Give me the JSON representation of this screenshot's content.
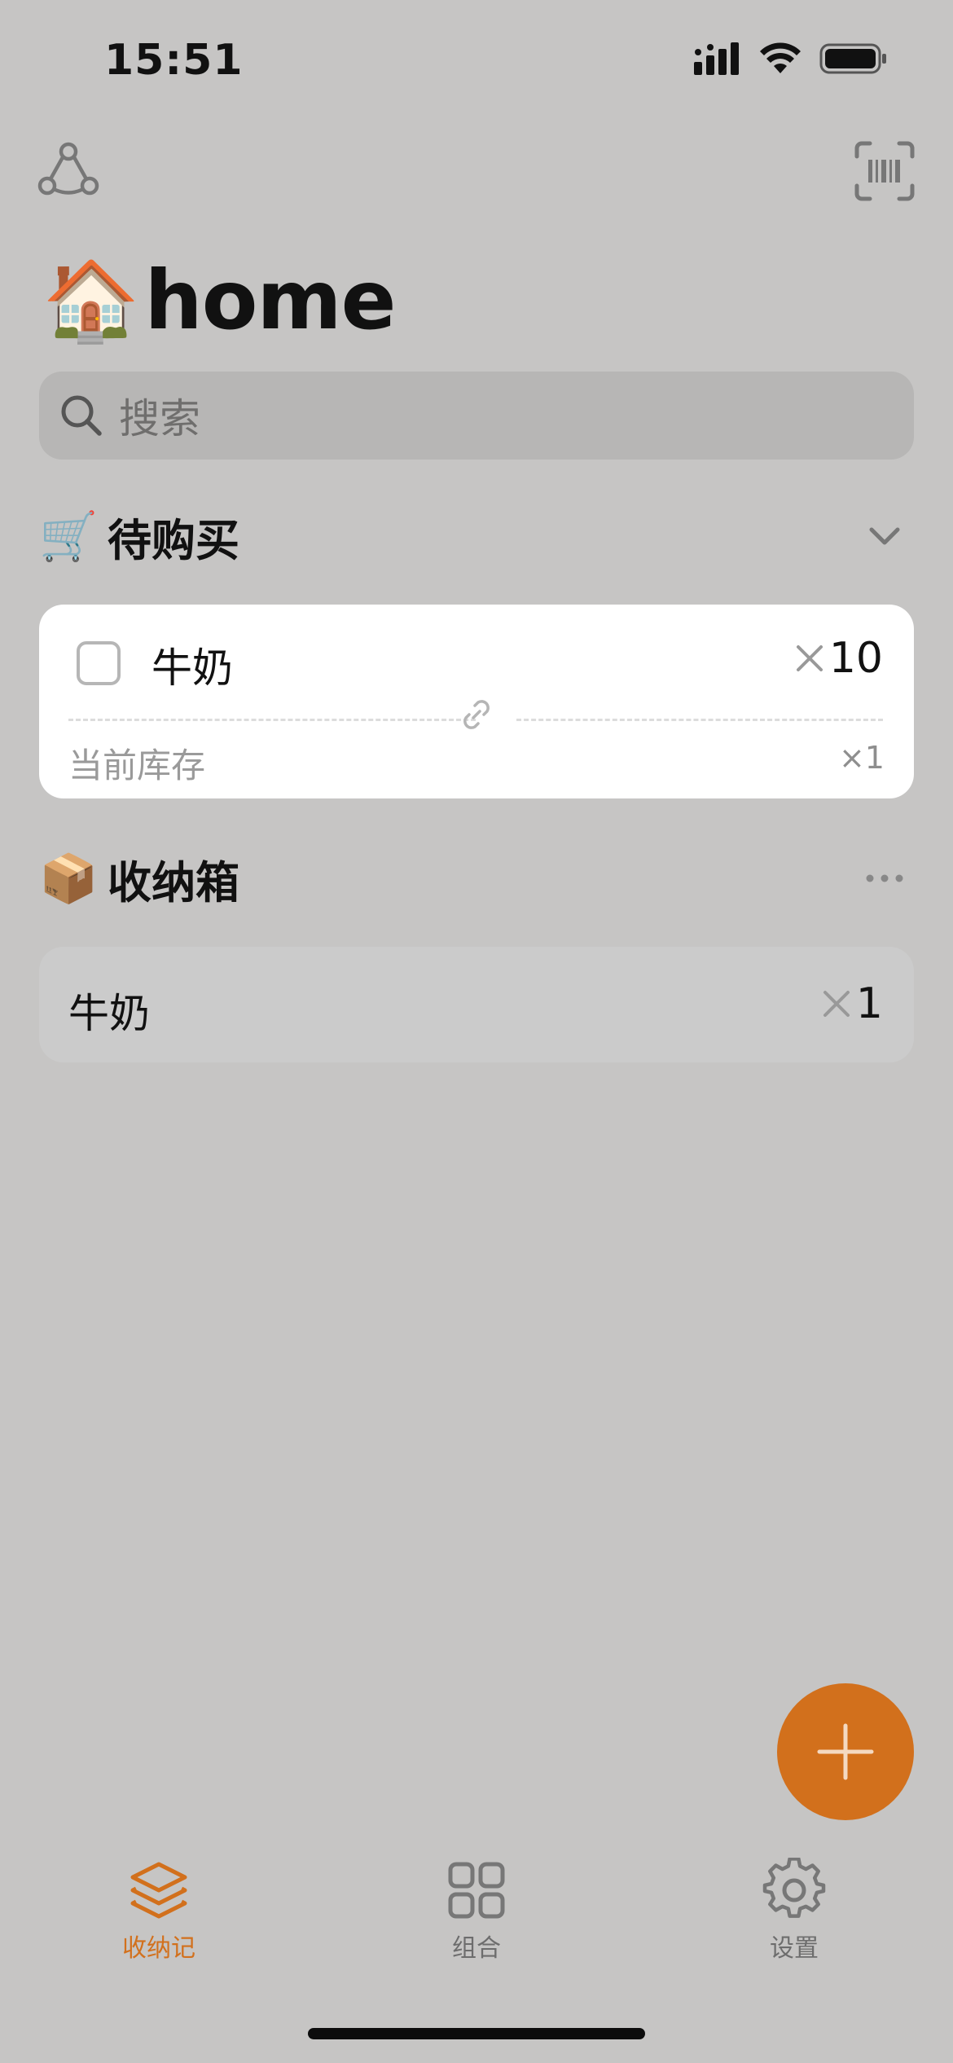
{
  "status_bar": {
    "time": "15:51"
  },
  "header": {
    "title_emoji": "🏠",
    "title": "home",
    "share_icon": "share-nodes-icon",
    "scan_icon": "barcode-scan-icon"
  },
  "search": {
    "placeholder": "搜索"
  },
  "shopping_section": {
    "emoji": "🛒",
    "title": "待购买",
    "items": [
      {
        "name": "牛奶",
        "quantity": "10",
        "stock_label": "当前库存",
        "stock_quantity": "×1",
        "checked": false
      }
    ]
  },
  "storage_section": {
    "emoji": "📦",
    "title": "收纳箱",
    "items": [
      {
        "name": "牛奶",
        "quantity": "1"
      }
    ]
  },
  "tabs": [
    {
      "label": "收纳记",
      "icon": "layers-icon",
      "active": true
    },
    {
      "label": "组合",
      "icon": "grid-icon",
      "active": false
    },
    {
      "label": "设置",
      "icon": "gear-icon",
      "active": false
    }
  ],
  "colors": {
    "accent": "#d2701c",
    "background": "#c6c5c4"
  }
}
